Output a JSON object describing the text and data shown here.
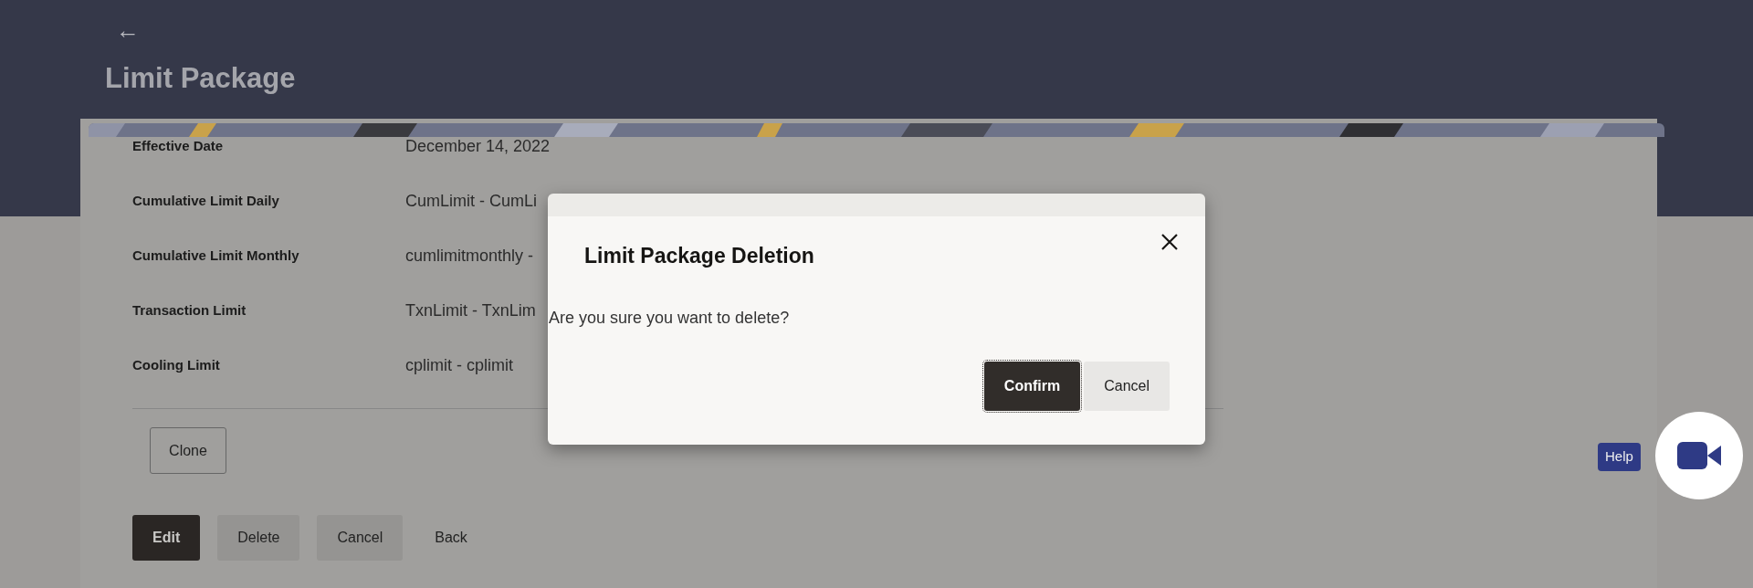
{
  "header": {
    "back": "←",
    "title": "Limit Package"
  },
  "details": [
    {
      "label": "Effective Date",
      "value": "December 14, 2022"
    },
    {
      "label": "Cumulative Limit Daily",
      "value": "CumLimit - CumLi"
    },
    {
      "label": "Cumulative Limit Monthly",
      "value": "cumlimitmonthly -"
    },
    {
      "label": "Transaction Limit",
      "value": "TxnLimit - TxnLim"
    },
    {
      "label": "Cooling Limit",
      "value": "cplimit - cplimit"
    }
  ],
  "clone_button": "Clone",
  "actions": [
    {
      "label": "Edit",
      "kind": "primary"
    },
    {
      "label": "Delete",
      "kind": "secondary"
    },
    {
      "label": "Cancel",
      "kind": "secondary"
    },
    {
      "label": "Back",
      "kind": "link"
    }
  ],
  "dialog": {
    "title": "Limit Package Deletion",
    "message": "Are you sure you want to delete?",
    "buttons": [
      {
        "label": "Confirm",
        "kind": "primary"
      },
      {
        "label": "Cancel",
        "kind": "secondary"
      }
    ]
  },
  "help": {
    "label": "Help"
  }
}
